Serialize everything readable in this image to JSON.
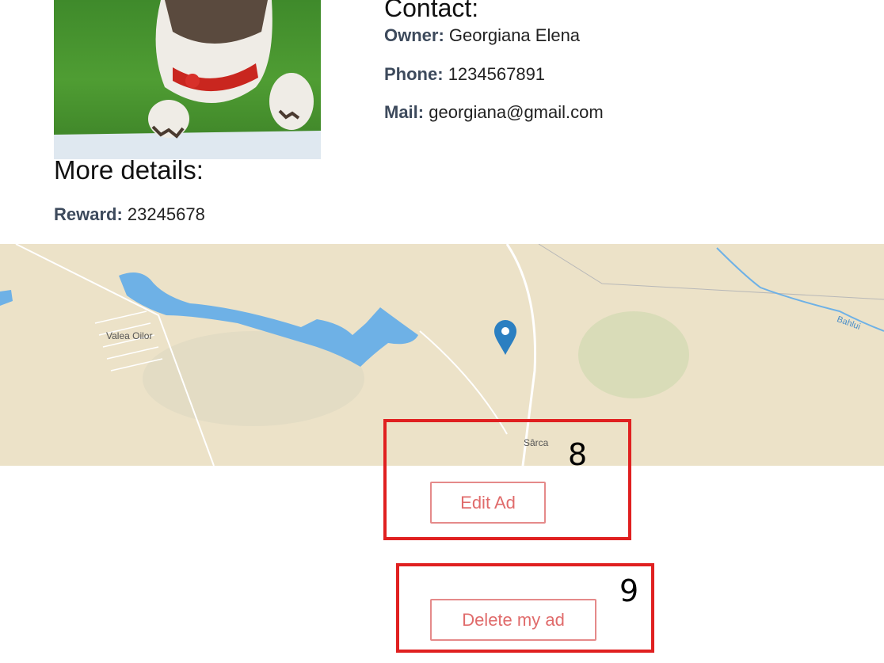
{
  "contact": {
    "title": "Contact:",
    "owner_label": "Owner:",
    "owner_value": "Georgiana Elena",
    "phone_label": "Phone:",
    "phone_value": "1234567891",
    "mail_label": "Mail:",
    "mail_value": "georgiana@gmail.com"
  },
  "details": {
    "title": "More details:",
    "reward_label": "Reward:",
    "reward_value": "23245678"
  },
  "map": {
    "labels": [
      "Valea Oilor",
      "Sârca",
      "Bahlui"
    ],
    "pin_color": "#2b7fc1",
    "water_color": "#6eb1e6"
  },
  "actions": {
    "edit_label": "Edit Ad",
    "delete_label": "Delete my ad"
  },
  "annotations": {
    "edit_marker": "8",
    "delete_marker": "9",
    "marker_color": "#e02020"
  }
}
